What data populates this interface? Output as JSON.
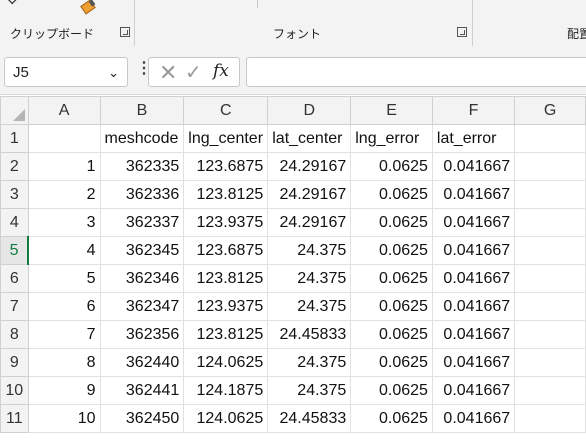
{
  "ribbon": {
    "clipboard_label": "クリップボード",
    "font_label": "フォント",
    "alignment_label": "配置"
  },
  "formula_bar": {
    "name_box": "J5",
    "formula": ""
  },
  "columns": [
    "",
    "A",
    "B",
    "C",
    "D",
    "E",
    "F",
    "G"
  ],
  "rows": [
    {
      "n": "1",
      "cells": [
        "",
        "meshcode",
        "lng_center",
        "lat_center",
        "lng_error",
        "lat_error"
      ]
    },
    {
      "n": "2",
      "cells": [
        "1",
        "362335",
        "123.6875",
        "24.29167",
        "0.0625",
        "0.041667"
      ]
    },
    {
      "n": "3",
      "cells": [
        "2",
        "362336",
        "123.8125",
        "24.29167",
        "0.0625",
        "0.041667"
      ]
    },
    {
      "n": "4",
      "cells": [
        "3",
        "362337",
        "123.9375",
        "24.29167",
        "0.0625",
        "0.041667"
      ]
    },
    {
      "n": "5",
      "cells": [
        "4",
        "362345",
        "123.6875",
        "24.375",
        "0.0625",
        "0.041667"
      ]
    },
    {
      "n": "6",
      "cells": [
        "5",
        "362346",
        "123.8125",
        "24.375",
        "0.0625",
        "0.041667"
      ]
    },
    {
      "n": "7",
      "cells": [
        "6",
        "362347",
        "123.9375",
        "24.375",
        "0.0625",
        "0.041667"
      ]
    },
    {
      "n": "8",
      "cells": [
        "7",
        "362356",
        "123.8125",
        "24.45833",
        "0.0625",
        "0.041667"
      ]
    },
    {
      "n": "9",
      "cells": [
        "8",
        "362440",
        "124.0625",
        "24.375",
        "0.0625",
        "0.041667"
      ]
    },
    {
      "n": "10",
      "cells": [
        "9",
        "362441",
        "124.1875",
        "24.375",
        "0.0625",
        "0.041667"
      ]
    },
    {
      "n": "11",
      "cells": [
        "10",
        "362450",
        "124.0625",
        "24.45833",
        "0.0625",
        "0.041667"
      ]
    }
  ],
  "active_row": "5",
  "colors": {
    "accent": "#107c41"
  }
}
